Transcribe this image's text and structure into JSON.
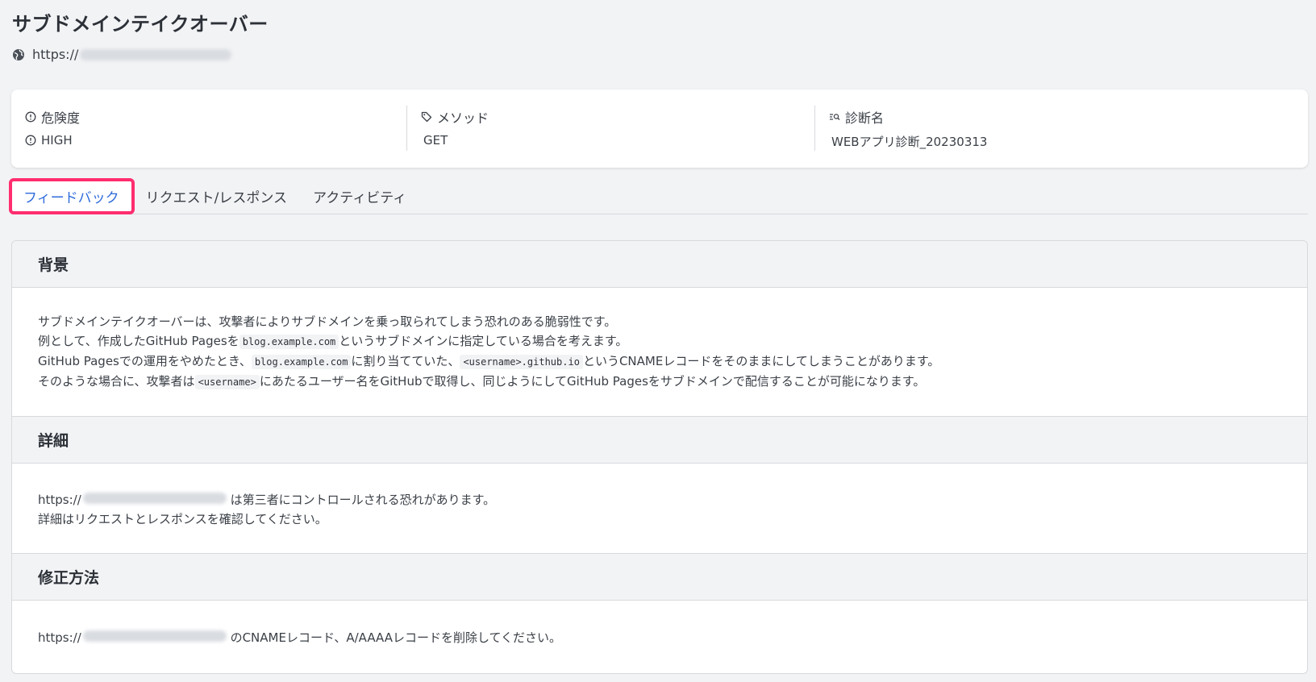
{
  "header": {
    "title": "サブドメインテイクオーバー",
    "url_prefix": "https://"
  },
  "info": {
    "risk": {
      "label": "危険度",
      "value": "HIGH"
    },
    "method": {
      "label": "メソッド",
      "value": "GET"
    },
    "diagnosis": {
      "label": "診断名",
      "value": "WEBアプリ診断_20230313"
    }
  },
  "tabs": [
    {
      "label": "フィードバック",
      "active": true
    },
    {
      "label": "リクエスト/レスポンス",
      "active": false
    },
    {
      "label": "アクティビティ",
      "active": false
    }
  ],
  "sections": {
    "background": {
      "title": "背景",
      "line1": "サブドメインテイクオーバーは、攻撃者によりサブドメインを乗っ取られてしまう恐れのある脆弱性です。",
      "line2_a": "例として、作成したGitHub Pagesを",
      "line2_code": "blog.example.com",
      "line2_b": "というサブドメインに指定している場合を考えます。",
      "line3_a": "GitHub Pagesでの運用をやめたとき、",
      "line3_code1": "blog.example.com",
      "line3_b": "に割り当てていた、",
      "line3_code2": "<username>.github.io",
      "line3_c": "というCNAMEレコードをそのままにしてしまうことがあります。",
      "line4_a": "そのような場合に、攻撃者は",
      "line4_code": "<username>",
      "line4_b": "にあたるユーザー名をGitHubで取得し、同じようにしてGitHub Pagesをサブドメインで配信することが可能になります。"
    },
    "details": {
      "title": "詳細",
      "line1_prefix": "https://",
      "line1_suffix": "は第三者にコントロールされる恐れがあります。",
      "line2": "詳細はリクエストとレスポンスを確認してください。"
    },
    "fix": {
      "title": "修正方法",
      "line1_prefix": "https://",
      "line1_suffix": "のCNAMEレコード、A/AAAAレコードを削除してください。"
    }
  },
  "colors": {
    "accent": "#2f6bdb",
    "highlight_border": "#ff2d6f",
    "background": "#f2f3f5"
  }
}
